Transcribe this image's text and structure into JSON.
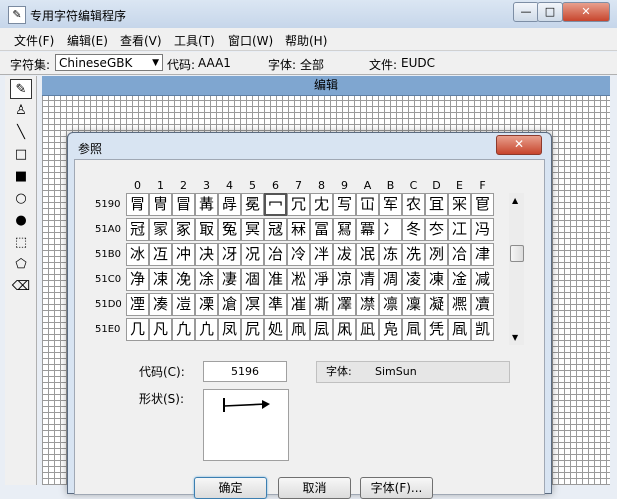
{
  "window": {
    "title": "专用字符编辑程序",
    "minimize_label": "—",
    "maximize_label": "□",
    "close_label": "✕"
  },
  "menu": [
    {
      "label": "文件(F)"
    },
    {
      "label": "编辑(E)"
    },
    {
      "label": "查看(V)"
    },
    {
      "label": "工具(T)"
    },
    {
      "label": "窗口(W)"
    },
    {
      "label": "帮助(H)"
    }
  ],
  "infobar": {
    "charset_label": "字符集:",
    "charset_value": "ChineseGBK",
    "code_label": "代码:",
    "code_value": "AAA1",
    "font_label": "字体:",
    "font_value": "全部",
    "file_label": "文件:",
    "file_value": "EUDC"
  },
  "toolbox": [
    {
      "name": "pencil-tool-icon",
      "glyph": "✎"
    },
    {
      "name": "brush-tool-icon",
      "glyph": "♙"
    },
    {
      "name": "line-tool-icon",
      "glyph": "╲"
    },
    {
      "name": "hollow-rect-tool-icon",
      "glyph": "□"
    },
    {
      "name": "filled-rect-tool-icon",
      "glyph": "■"
    },
    {
      "name": "hollow-ellipse-tool-icon",
      "glyph": "○"
    },
    {
      "name": "filled-ellipse-tool-icon",
      "glyph": "●"
    },
    {
      "name": "rect-select-tool-icon",
      "glyph": "⬚"
    },
    {
      "name": "freeform-select-tool-icon",
      "glyph": "⬠"
    },
    {
      "name": "eraser-tool-icon",
      "glyph": "⌫"
    }
  ],
  "editor": {
    "header": "编辑"
  },
  "dialog": {
    "title": "参照",
    "close_label": "✕",
    "column_headers": [
      "0",
      "1",
      "2",
      "3",
      "4",
      "5",
      "6",
      "7",
      "8",
      "9",
      "A",
      "B",
      "C",
      "D",
      "E",
      "F"
    ],
    "rows": [
      {
        "code": "5190",
        "chars": [
          "冐",
          "冑",
          "冒",
          "冓",
          "冔",
          "冕",
          "冖",
          "冗",
          "冘",
          "写",
          "冚",
          "军",
          "农",
          "冝",
          "冞",
          "冟"
        ]
      },
      {
        "code": "51A0",
        "chars": [
          "冠",
          "冡",
          "冢",
          "冣",
          "冤",
          "冥",
          "冦",
          "冧",
          "冨",
          "冩",
          "冪",
          "冫",
          "冬",
          "冭",
          "冮",
          "冯"
        ]
      },
      {
        "code": "51B0",
        "chars": [
          "冰",
          "冱",
          "冲",
          "决",
          "冴",
          "况",
          "冶",
          "冷",
          "冸",
          "冹",
          "冺",
          "冻",
          "冼",
          "冽",
          "冾",
          "冿"
        ]
      },
      {
        "code": "51C0",
        "chars": [
          "净",
          "凁",
          "凂",
          "凃",
          "凄",
          "凅",
          "准",
          "凇",
          "凈",
          "凉",
          "凊",
          "凋",
          "凌",
          "凍",
          "凎",
          "减"
        ]
      },
      {
        "code": "51D0",
        "chars": [
          "凐",
          "凑",
          "凒",
          "凓",
          "凔",
          "凕",
          "凖",
          "凗",
          "凘",
          "凙",
          "凚",
          "凛",
          "凜",
          "凝",
          "凞",
          "凟"
        ]
      },
      {
        "code": "51E0",
        "chars": [
          "几",
          "凡",
          "凢",
          "凣",
          "凤",
          "凥",
          "処",
          "凧",
          "凨",
          "凩",
          "凪",
          "凫",
          "凬",
          "凭",
          "凮",
          "凯"
        ]
      }
    ],
    "selected": {
      "row": 0,
      "col": 6
    },
    "code_label": "代码(C):",
    "code_value": "5196",
    "font_label": "字体:",
    "font_value": "SimSun",
    "shape_label": "形状(S):",
    "ok_label": "确定",
    "cancel_label": "取消",
    "font_button_label": "字体(F)..."
  }
}
